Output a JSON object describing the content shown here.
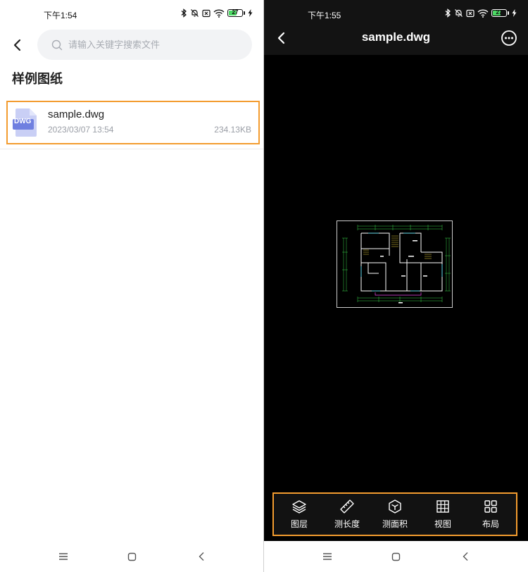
{
  "left_screen": {
    "status": {
      "time": "下午1:54",
      "battery": "27"
    },
    "search": {
      "placeholder": "请输入关键字搜索文件"
    },
    "section_title": "样例图纸",
    "files": [
      {
        "icon_label": "DWG",
        "name": "sample.dwg",
        "date": "2023/03/07  13:54",
        "size": "234.13KB"
      }
    ]
  },
  "right_screen": {
    "status": {
      "time": "下午1:55",
      "battery": "27"
    },
    "title": "sample.dwg",
    "toolbar": {
      "items": [
        {
          "icon": "layers-icon",
          "label": "图层"
        },
        {
          "icon": "ruler-icon",
          "label": "测长度"
        },
        {
          "icon": "cube-icon",
          "label": "测面积"
        },
        {
          "icon": "grid-view-icon",
          "label": "视图"
        },
        {
          "icon": "layout-icon",
          "label": "布局"
        }
      ]
    }
  },
  "colors": {
    "highlight_border": "#f39c2f",
    "file_icon": "#6f7fe0",
    "viewer_background": "#000000",
    "cad_lines": "#ffffff",
    "cad_dimensions": "#3ad14a",
    "cad_accent": "#e84ce8"
  }
}
